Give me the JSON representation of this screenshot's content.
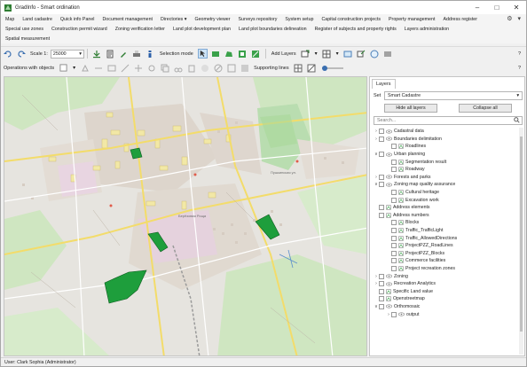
{
  "window": {
    "title": "GradInfo - Smart ordination",
    "controls": [
      "minimize",
      "maximize",
      "close"
    ]
  },
  "menu": {
    "row1": [
      "Map",
      "Land cadastre",
      "Quick info Panel",
      "Document management",
      "Directories ▾",
      "Geometry viewer",
      "Surveys repository",
      "System setup",
      "Capital construction projects",
      "Property management",
      "Address register"
    ],
    "row2": [
      "Special use zones",
      "Construction permit wizard",
      "Zoning verification letter",
      "Land plot development plan",
      "Land plot boundaries delineation",
      "Register of subjects and property rights",
      "Layers administration"
    ],
    "row3": [
      "Spatial measurement"
    ]
  },
  "toolbar1": {
    "scale_label": "Scale 1:",
    "scale_value": "25000",
    "selection_mode_label": "Selection mode",
    "add_layers_label": "Add Layers",
    "help": "?"
  },
  "toolbar2": {
    "operations_label": "Operations with objects",
    "supporting_lines_label": "Supporting lines",
    "help": "?"
  },
  "map": {
    "labels": [
      "Берёзовая Роща",
      "Пушкинская ул."
    ]
  },
  "layers_panel": {
    "tab": "Layers",
    "set_label": "Set",
    "set_value": "Smart Cadastre",
    "hide_all_button": "Hide all layers",
    "collapse_all_button": "Collapse all",
    "search_placeholder": "Search...",
    "tree": [
      {
        "label": "Cadastral data",
        "level": 0,
        "arrow": "›",
        "type": "group"
      },
      {
        "label": "Boundaries delimitation",
        "level": 0,
        "arrow": "›",
        "type": "group"
      },
      {
        "label": "Roadlines",
        "level": 1,
        "arrow": "",
        "type": "layer"
      },
      {
        "label": "Urban planning",
        "level": 0,
        "arrow": "∨",
        "type": "group"
      },
      {
        "label": "Segmentation result",
        "level": 1,
        "arrow": "",
        "type": "layer"
      },
      {
        "label": "Roadway",
        "level": 1,
        "arrow": "",
        "type": "layer"
      },
      {
        "label": "Forests and parks",
        "level": 0,
        "arrow": "›",
        "type": "group"
      },
      {
        "label": "Zoning map quality assurance",
        "level": 0,
        "arrow": "∨",
        "type": "group"
      },
      {
        "label": "Cultural heritage",
        "level": 1,
        "arrow": "",
        "type": "layer"
      },
      {
        "label": "Excavation work",
        "level": 1,
        "arrow": "",
        "type": "layer"
      },
      {
        "label": "Address elements",
        "level": 0,
        "arrow": "",
        "type": "layer"
      },
      {
        "label": "Address numbers",
        "level": 0,
        "arrow": "",
        "type": "layer"
      },
      {
        "label": "Blocks",
        "level": 1,
        "arrow": "",
        "type": "layer"
      },
      {
        "label": "Traffic_TrafficLight",
        "level": 1,
        "arrow": "",
        "type": "layer"
      },
      {
        "label": "Traffic_AllowedDirections",
        "level": 1,
        "arrow": "",
        "type": "layer"
      },
      {
        "label": "ProjectPZZ_RoadLines",
        "level": 1,
        "arrow": "",
        "type": "layer"
      },
      {
        "label": "ProjectPZZ_Blocks",
        "level": 1,
        "arrow": "",
        "type": "layer"
      },
      {
        "label": "Commerce facilities",
        "level": 1,
        "arrow": "",
        "type": "layer"
      },
      {
        "label": "Project recreation zones",
        "level": 1,
        "arrow": "",
        "type": "layer"
      },
      {
        "label": "Zoning",
        "level": 0,
        "arrow": "›",
        "type": "group"
      },
      {
        "label": "Recreation Analytics",
        "level": 0,
        "arrow": "›",
        "type": "group"
      },
      {
        "label": "Specific Land value",
        "level": 0,
        "arrow": "",
        "type": "layer"
      },
      {
        "label": "Openstreetmap",
        "level": 0,
        "arrow": "",
        "type": "layer"
      },
      {
        "label": "Orthomosaic",
        "level": 0,
        "arrow": "∨",
        "type": "group"
      },
      {
        "label": "output",
        "level": 1,
        "arrow": "›",
        "type": "group"
      }
    ]
  },
  "status": {
    "user": "User: Clark Sophia  (Administrator)"
  },
  "colors": {
    "accent_green": "#1e9e3c",
    "map_bg": "#e6e4df",
    "road_yellow": "#f6e27a"
  }
}
